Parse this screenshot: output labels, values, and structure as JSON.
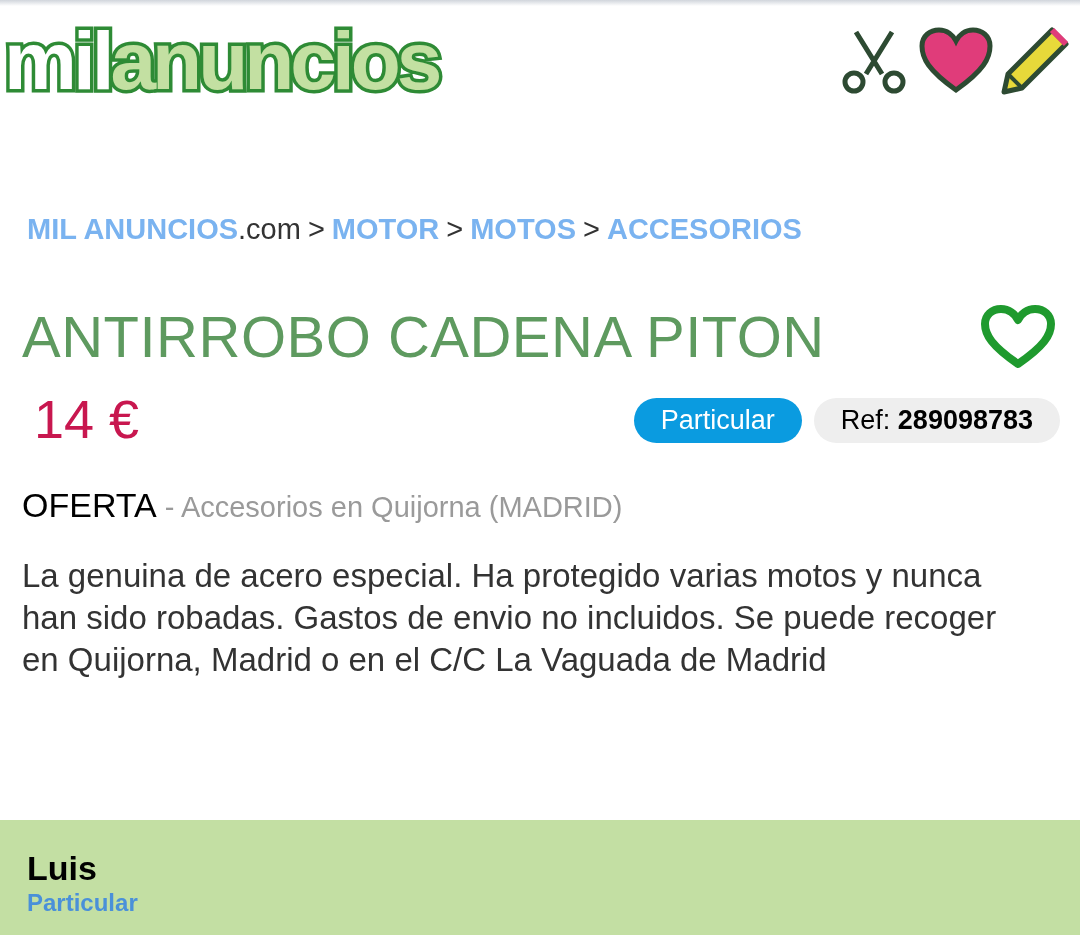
{
  "header": {
    "logo": {
      "first": "mil",
      "second": "anuncios"
    }
  },
  "breadcrumb": [
    {
      "kind": "link",
      "text": "MIL ANUNCIOS"
    },
    {
      "kind": "text",
      "text": ".com"
    },
    {
      "kind": "separator",
      "text": ">"
    },
    {
      "kind": "link",
      "text": "MOTOR"
    },
    {
      "kind": "separator",
      "text": ">"
    },
    {
      "kind": "link",
      "text": "MOTOS"
    },
    {
      "kind": "separator",
      "text": ">"
    },
    {
      "kind": "link",
      "text": "ACCESORIOS"
    }
  ],
  "ad": {
    "title": "ANTIRROBO CADENA PITON",
    "favorite": false,
    "price": "14 €",
    "seller_type_badge": "Particular",
    "ref_label": "Ref:",
    "ref_value": "289098783",
    "offer_type": "OFERTA",
    "location": "- Accesorios en Quijorna (MADRID)",
    "description": "La genuina de acero especial. Ha protegido varias motos y nunca han sido robadas. Gastos de envio no incluidos. Se puede recoger en Quijorna, Madrid o en el C/C La Vaguada de Madrid"
  },
  "seller": {
    "name": "Luis",
    "type": "Particular"
  }
}
